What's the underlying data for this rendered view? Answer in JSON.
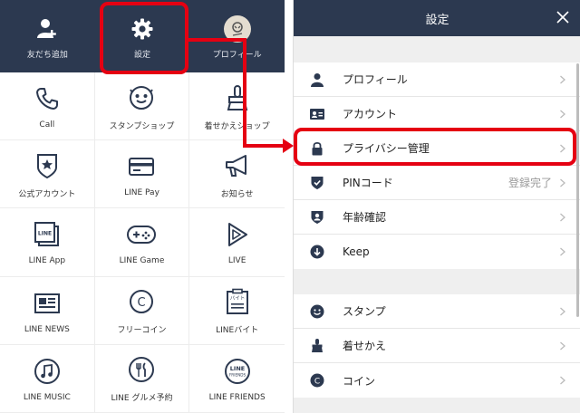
{
  "left_panel": {
    "top_items": [
      {
        "label": "友だち追加",
        "icon": "add-friend-icon"
      },
      {
        "label": "設定",
        "icon": "gear-icon"
      },
      {
        "label": "プロフィール",
        "icon": "profile-avatar-icon"
      }
    ],
    "grid_items": [
      {
        "label": "Call",
        "icon": "phone-icon"
      },
      {
        "label": "スタンプショップ",
        "icon": "sticker-face-icon"
      },
      {
        "label": "着せかえショップ",
        "icon": "theme-brush-icon"
      },
      {
        "label": "公式アカウント",
        "icon": "official-account-shield-icon"
      },
      {
        "label": "LINE Pay",
        "icon": "card-icon"
      },
      {
        "label": "お知らせ",
        "icon": "megaphone-icon"
      },
      {
        "label": "LINE App",
        "icon": "line-app-icon"
      },
      {
        "label": "LINE Game",
        "icon": "gamepad-icon"
      },
      {
        "label": "LIVE",
        "icon": "live-play-icon"
      },
      {
        "label": "LINE NEWS",
        "icon": "news-icon"
      },
      {
        "label": "フリーコイン",
        "icon": "coin-icon"
      },
      {
        "label": "LINEバイト",
        "icon": "job-icon"
      },
      {
        "label": "LINE MUSIC",
        "icon": "music-icon"
      },
      {
        "label": "LINE グルメ予約",
        "icon": "dining-icon"
      },
      {
        "label": "LINE FRIENDS",
        "icon": "line-friends-icon"
      }
    ],
    "icon_text": {
      "line_app": "LINE",
      "job": "バイト",
      "friends_top": "LINE",
      "friends_bottom": "FRIENDS",
      "coin": "C"
    }
  },
  "right_panel": {
    "title": "設定",
    "group1": [
      {
        "label": "プロフィール",
        "value": "",
        "icon": "person-icon"
      },
      {
        "label": "アカウント",
        "value": "",
        "icon": "id-card-icon"
      },
      {
        "label": "プライバシー管理",
        "value": "",
        "icon": "lock-icon"
      },
      {
        "label": "PINコード",
        "value": "登録完了",
        "icon": "shield-check-icon"
      },
      {
        "label": "年齢確認",
        "value": "",
        "icon": "age-shield-icon"
      },
      {
        "label": "Keep",
        "value": "",
        "icon": "keep-icon"
      }
    ],
    "group2": [
      {
        "label": "スタンプ",
        "value": "",
        "icon": "smile-icon"
      },
      {
        "label": "着せかえ",
        "value": "",
        "icon": "brush-icon"
      },
      {
        "label": "コイン",
        "value": "",
        "icon": "coin-icon"
      }
    ]
  },
  "colors": {
    "header_bg": "#2c3950",
    "highlight": "#e50012",
    "icon": "#2c3950"
  }
}
